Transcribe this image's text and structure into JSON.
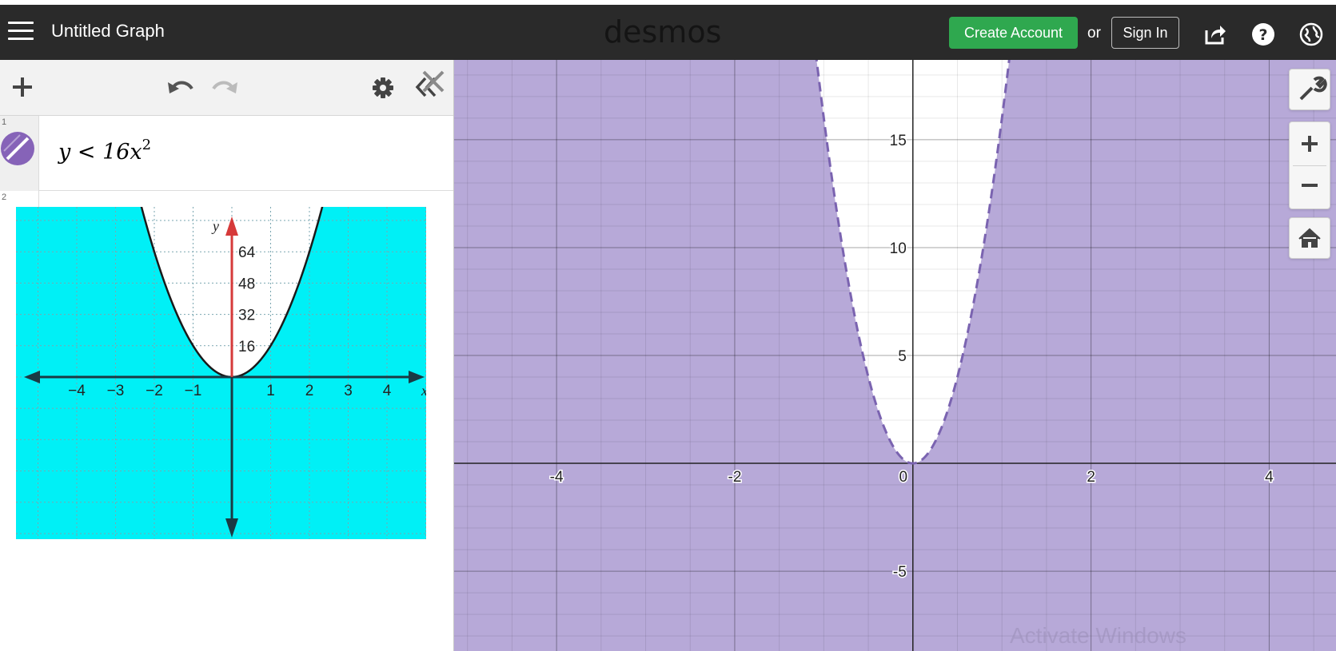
{
  "header": {
    "title": "Untitled Graph",
    "brand": "desmos",
    "create_account": "Create Account",
    "or": "or",
    "sign_in": "Sign In"
  },
  "expressions": [
    {
      "index": "1",
      "latex_parts": {
        "lhs": "y",
        "op": "<",
        "coef": "16x",
        "exp": "2"
      },
      "color": "#8663b8"
    },
    {
      "index": "2",
      "type": "image"
    }
  ],
  "image_graph": {
    "y_labels": [
      "64",
      "48",
      "32",
      "16"
    ],
    "x_labels": [
      "−4",
      "−3",
      "−2",
      "−1",
      "1",
      "2",
      "3",
      "4"
    ],
    "axis_y": "y",
    "axis_x": "x"
  },
  "graph": {
    "x_range": [
      -5.15,
      4.75
    ],
    "y_range": [
      -8.7,
      18.7
    ],
    "x_labels": [
      "-4",
      "-2",
      "0",
      "2",
      "4"
    ],
    "y_labels": [
      "15",
      "10",
      "5",
      "-5"
    ],
    "fill_color": "#b7a9d8",
    "curve_color": "#7a63b0"
  },
  "watermark": "Activate Windows",
  "colors": {
    "header_bg": "#2a2a2a",
    "create_btn": "#2fa84f",
    "image_bg": "#00f0f6",
    "shade": "#b7a9d8"
  }
}
